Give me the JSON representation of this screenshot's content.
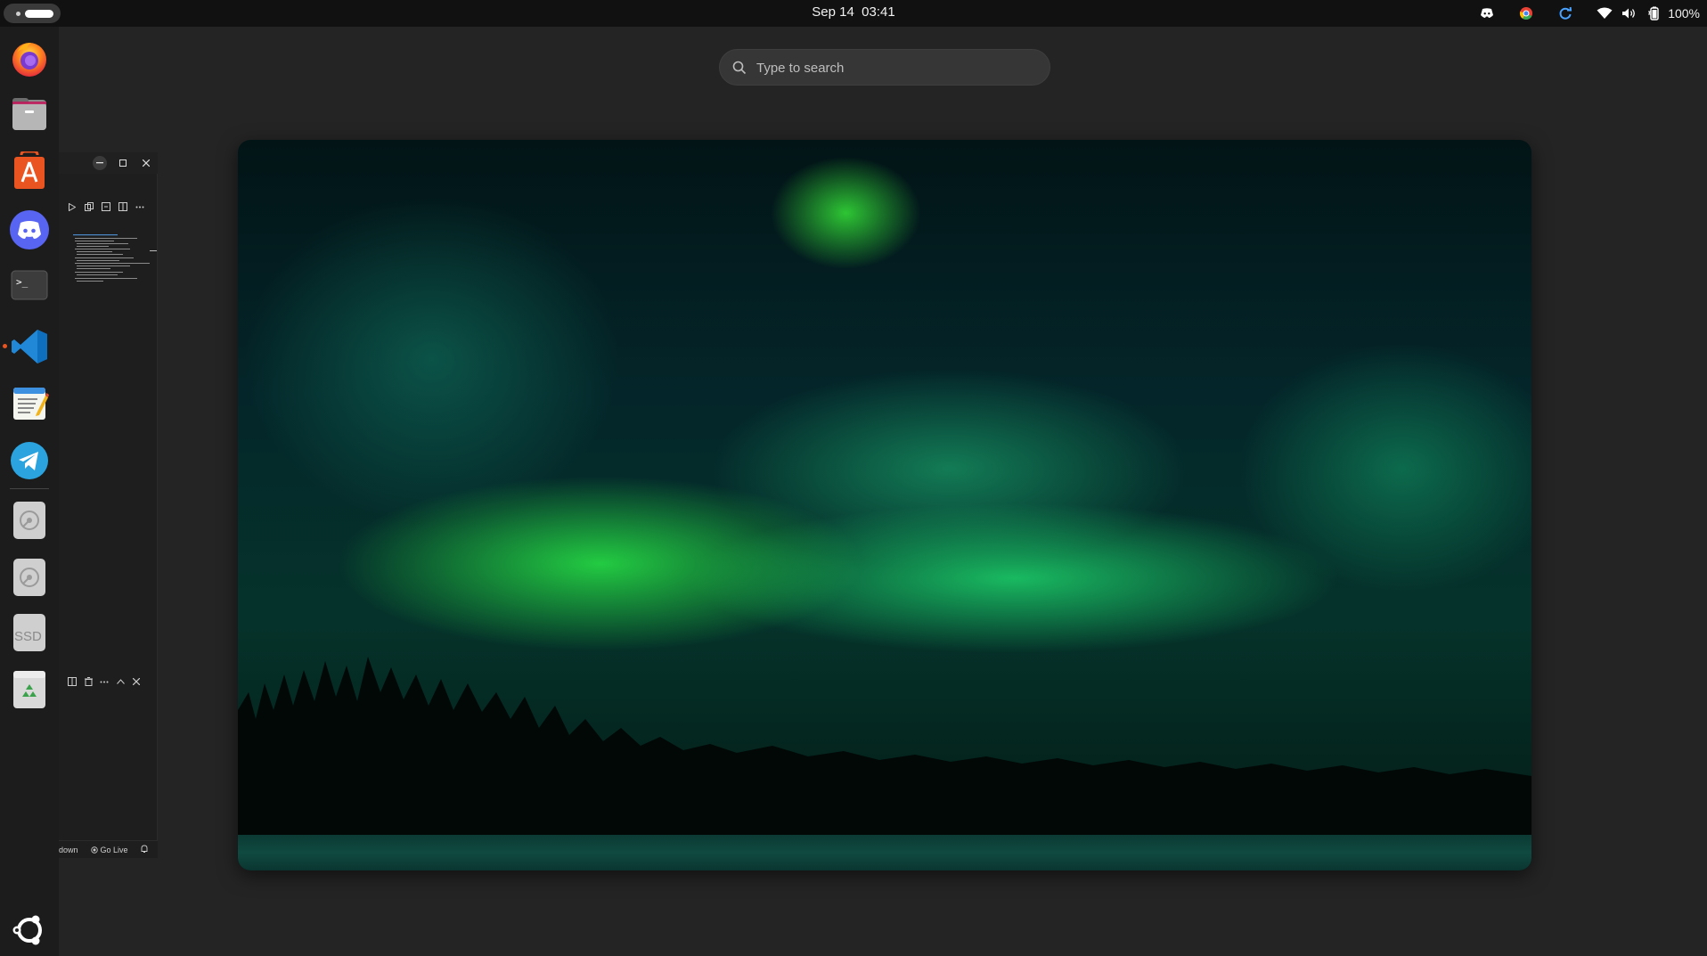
{
  "topbar": {
    "clock_date": "Sep 14",
    "clock_time": "03:41",
    "battery_label": "100%",
    "tray_icons": [
      "discord-tray-icon",
      "chrome-tray-icon",
      "sync-tray-icon",
      "wifi-icon",
      "volume-icon",
      "battery-icon"
    ]
  },
  "dock": {
    "apps": [
      {
        "name": "firefox",
        "icon": "firefox-icon"
      },
      {
        "name": "files",
        "icon": "files-icon"
      },
      {
        "name": "app-center",
        "icon": "app-center-icon"
      },
      {
        "name": "discord",
        "icon": "discord-icon"
      },
      {
        "name": "terminal",
        "icon": "terminal-icon"
      },
      {
        "name": "vscode",
        "icon": "vscode-icon",
        "running": true
      },
      {
        "name": "text-editor",
        "icon": "text-editor-icon"
      },
      {
        "name": "telegram",
        "icon": "telegram-icon"
      },
      {
        "name": "disk-1",
        "icon": "disk-drive-icon"
      },
      {
        "name": "disk-2",
        "icon": "disk-drive-icon"
      },
      {
        "name": "ssd",
        "icon": "ssd-icon",
        "label": "SSD"
      },
      {
        "name": "trash",
        "icon": "trash-icon"
      }
    ],
    "show_apps": "ubuntu-logo-icon",
    "accent": "#e95420"
  },
  "search": {
    "placeholder": "Type to search"
  },
  "code_window": {
    "status_left": "down",
    "status_golive": "Go Live"
  }
}
